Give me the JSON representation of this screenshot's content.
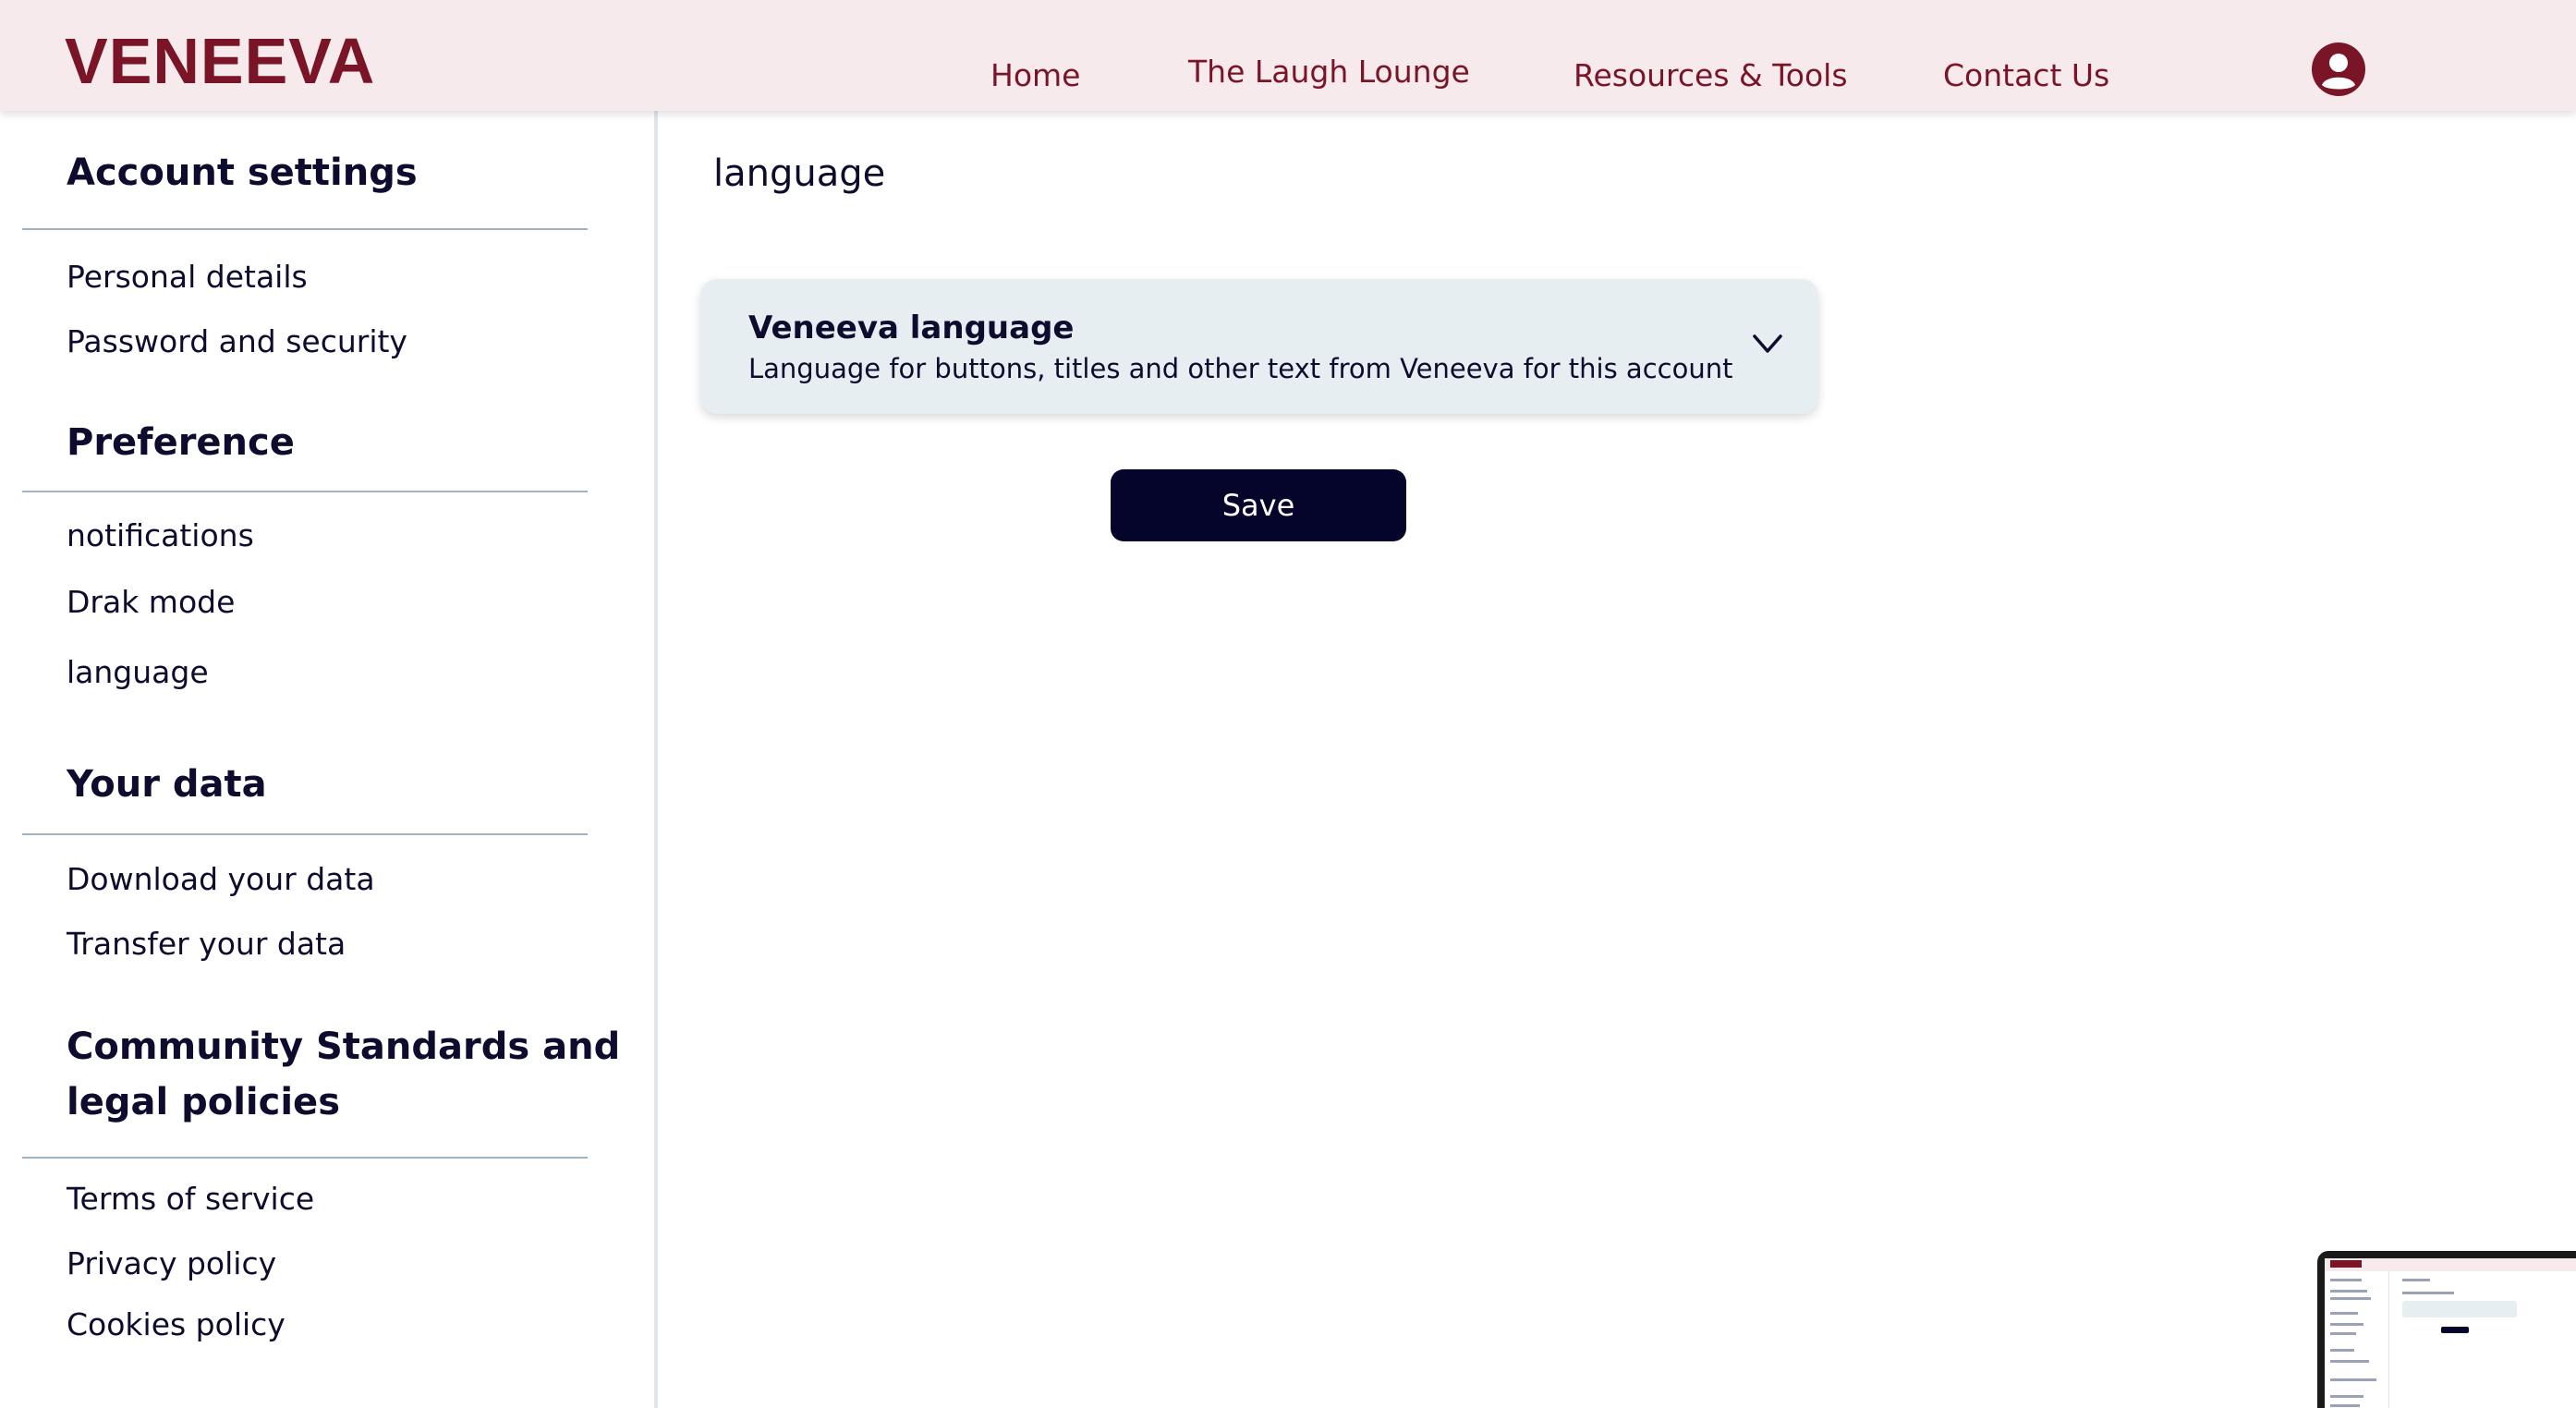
{
  "header": {
    "logo": "VENEEVA",
    "nav": {
      "home": "Home",
      "laugh_lounge": "The Laugh Lounge",
      "resources": "Resources & Tools",
      "contact": "Contact Us"
    },
    "avatar_icon": "user-circle-icon"
  },
  "sidebar": {
    "account": {
      "title": "Account settings",
      "items": [
        "Personal details",
        "Password and security"
      ]
    },
    "preference": {
      "title": "Preference",
      "items": [
        "notifications",
        "Drak mode",
        "language"
      ]
    },
    "your_data": {
      "title": "Your data",
      "items": [
        "Download your data",
        "Transfer your data"
      ]
    },
    "community": {
      "title_line1": "Community Standards and",
      "title_line2": "legal policies",
      "items": [
        "Terms of service",
        "Privacy policy",
        "Cookies policy"
      ]
    }
  },
  "main": {
    "page_title": "language",
    "language_card": {
      "title": "Veneeva language",
      "description": "Language for buttons, titles and other text from Veneeva for this account",
      "chevron_icon": "chevron-down-icon"
    },
    "save_label": "Save"
  },
  "colors": {
    "brand": "#7a1427",
    "header_bg": "#f6eaec",
    "navy": "#05042a",
    "card_bg": "#e7eef2"
  }
}
